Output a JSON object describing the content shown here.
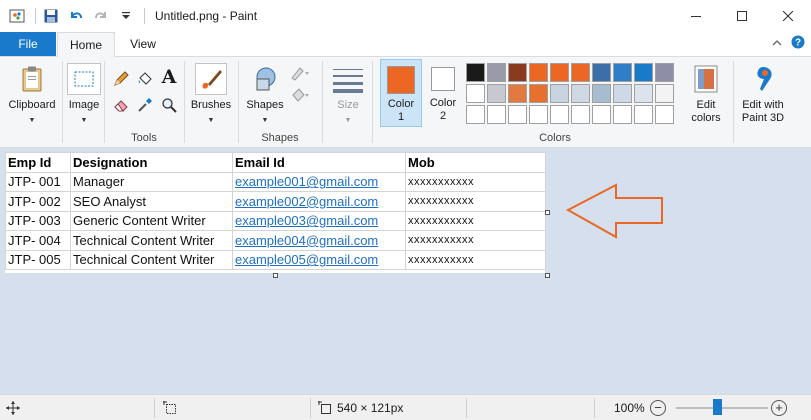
{
  "window": {
    "title": "Untitled.png - Paint",
    "qat_customize_icon": "dropdown-arrow-icon"
  },
  "tabs": [
    {
      "label": "File"
    },
    {
      "label": "Home"
    },
    {
      "label": "View"
    }
  ],
  "ribbon": {
    "clipboard": {
      "label": "Clipboard"
    },
    "image": {
      "label": "Image"
    },
    "tools": {
      "group_label": "Tools",
      "text_tool": "A"
    },
    "brushes": {
      "label": "Brushes"
    },
    "shapes": {
      "label": "Shapes",
      "group_label": "Shapes"
    },
    "size": {
      "label": "Size"
    },
    "color1": {
      "label_line1": "Color",
      "label_line2": "1",
      "value": "#ec6723"
    },
    "color2": {
      "label_line1": "Color",
      "label_line2": "2",
      "value": "#ffffff"
    },
    "colors_group_label": "Colors",
    "edit_colors": {
      "line1": "Edit",
      "line2": "colors"
    },
    "edit_3d": {
      "line1": "Edit with",
      "line2": "Paint 3D"
    },
    "palette": [
      "#1a1a1a",
      "#9a9aa8",
      "#8a3a1e",
      "#ec6723",
      "#ec6723",
      "#ec6723",
      "#3c6fa8",
      "#2f7fc8",
      "#1979ca",
      "#8e8ea6",
      "#ffffff",
      "#c8c8d0",
      "#e07a3e",
      "#e8702e",
      "#c8d4e0",
      "#d0d8e4",
      "#a8bcd0",
      "#cfd8e6",
      "#dde3ec",
      "#f3f3f3",
      "#ffffff",
      "#ffffff",
      "#ffffff",
      "#ffffff",
      "#ffffff",
      "#ffffff",
      "#ffffff",
      "#ffffff",
      "#ffffff",
      "#ffffff"
    ]
  },
  "sheet": {
    "headers": [
      "Emp Id",
      "Designation",
      "Email Id",
      "Mob"
    ],
    "rows": [
      [
        "JTP- 001",
        "Manager",
        "example001@gmail.com",
        "xxxxxxxxxxx"
      ],
      [
        "JTP- 002",
        "SEO Analyst",
        "example002@gmail.com",
        "xxxxxxxxxxx"
      ],
      [
        "JTP- 003",
        "Generic Content Writer",
        "example003@gmail.com",
        "xxxxxxxxxxx"
      ],
      [
        "JTP- 004",
        "Technical Content Writer",
        "example004@gmail.com",
        "xxxxxxxxxxx"
      ],
      [
        "JTP- 005",
        "Technical Content Writer",
        "example005@gmail.com",
        "xxxxxxxxxxx"
      ]
    ]
  },
  "annotation": {
    "arrow_color": "#ec6723"
  },
  "status": {
    "image_size": "540 × 121px",
    "zoom": "100%",
    "zoom_level": 0.5
  }
}
